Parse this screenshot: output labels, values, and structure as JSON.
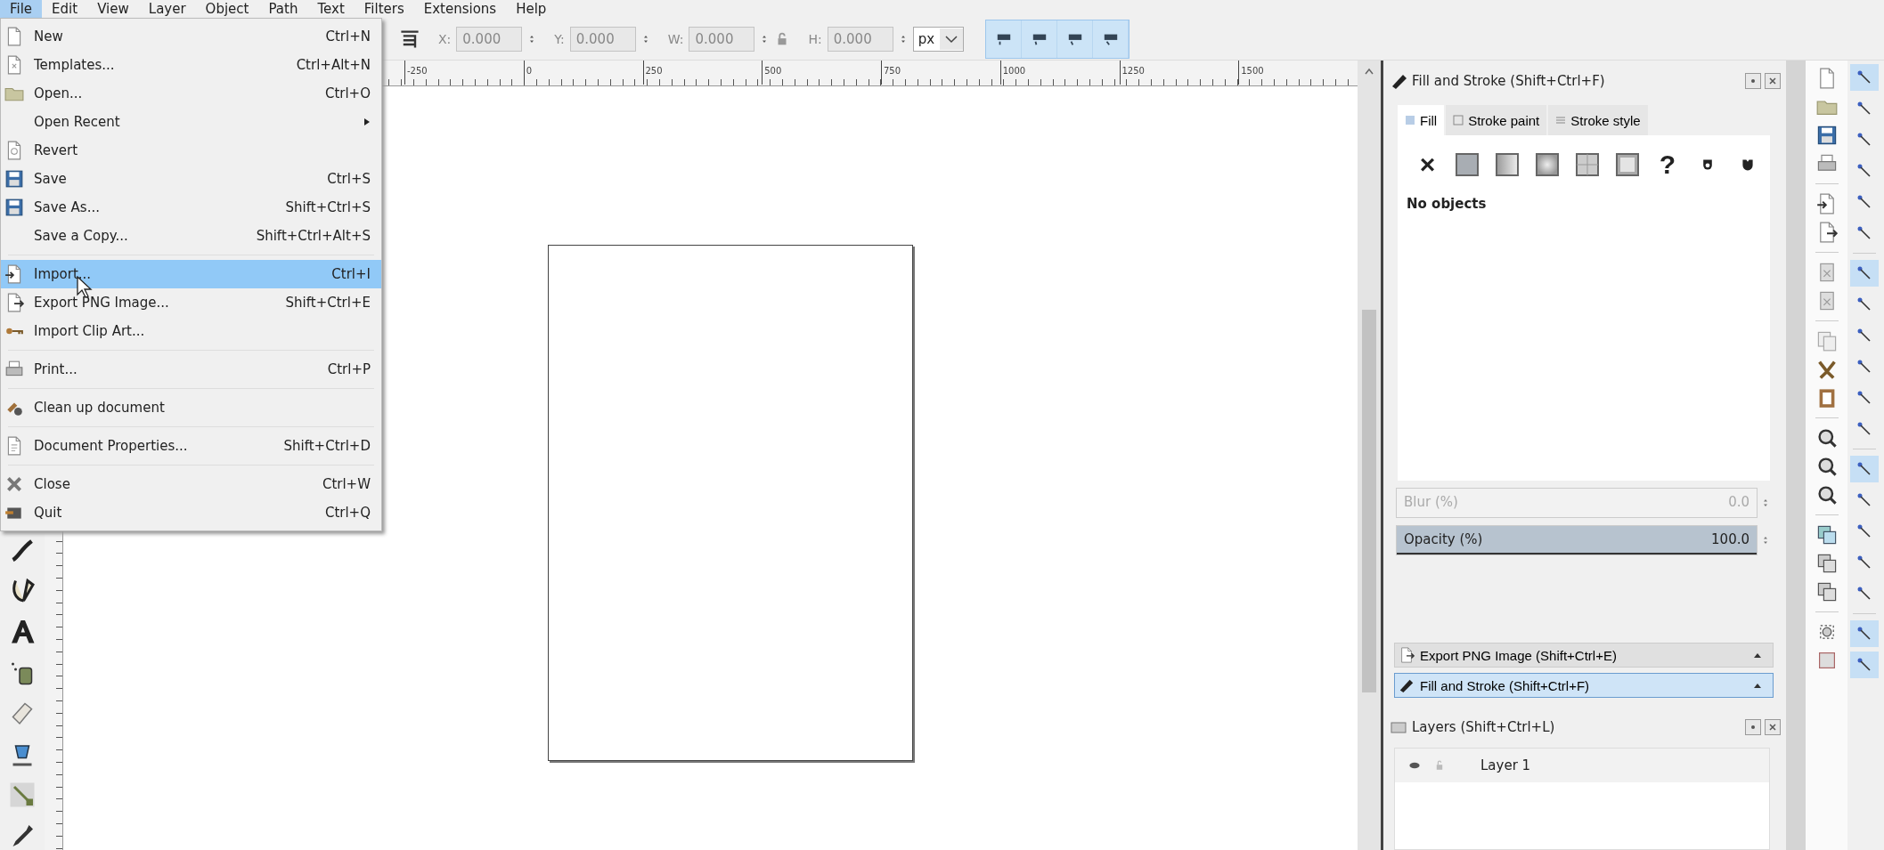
{
  "menubar": {
    "items": [
      {
        "label": "File",
        "selected": true
      },
      {
        "label": "Edit",
        "selected": false
      },
      {
        "label": "View",
        "selected": false
      },
      {
        "label": "Layer",
        "selected": false
      },
      {
        "label": "Object",
        "selected": false
      },
      {
        "label": "Path",
        "selected": false
      },
      {
        "label": "Text",
        "selected": false
      },
      {
        "label": "Filters",
        "selected": false
      },
      {
        "label": "Extensions",
        "selected": false
      },
      {
        "label": "Help",
        "selected": false
      }
    ]
  },
  "file_menu": {
    "items": [
      {
        "kind": "item",
        "label": "New",
        "shortcut": "Ctrl+N",
        "selected": false
      },
      {
        "kind": "item",
        "label": "Templates...",
        "shortcut": "Ctrl+Alt+N",
        "selected": false
      },
      {
        "kind": "item",
        "label": "Open...",
        "shortcut": "Ctrl+O",
        "selected": false
      },
      {
        "kind": "submenu",
        "label": "Open Recent",
        "selected": false
      },
      {
        "kind": "item",
        "label": "Revert",
        "selected": false
      },
      {
        "kind": "item",
        "label": "Save",
        "shortcut": "Ctrl+S",
        "selected": false
      },
      {
        "kind": "item",
        "label": "Save As...",
        "shortcut": "Shift+Ctrl+S",
        "selected": false
      },
      {
        "kind": "item",
        "label": "Save a Copy...",
        "shortcut": "Shift+Ctrl+Alt+S",
        "selected": false
      },
      {
        "kind": "separator"
      },
      {
        "kind": "item",
        "label": "Import...",
        "shortcut": "Ctrl+I",
        "selected": true
      },
      {
        "kind": "item",
        "label": "Export PNG Image...",
        "shortcut": "Shift+Ctrl+E",
        "selected": false
      },
      {
        "kind": "item",
        "label": "Import Clip Art...",
        "selected": false
      },
      {
        "kind": "separator"
      },
      {
        "kind": "item",
        "label": "Print...",
        "shortcut": "Ctrl+P",
        "selected": false
      },
      {
        "kind": "separator"
      },
      {
        "kind": "item",
        "label": "Clean up document",
        "selected": false
      },
      {
        "kind": "separator"
      },
      {
        "kind": "item",
        "label": "Document Properties...",
        "shortcut": "Shift+Ctrl+D",
        "selected": false
      },
      {
        "kind": "separator"
      },
      {
        "kind": "item",
        "label": "Close",
        "shortcut": "Ctrl+W",
        "selected": false
      },
      {
        "kind": "item",
        "label": "Quit",
        "shortcut": "Ctrl+Q",
        "selected": false
      }
    ]
  },
  "toolbar": {
    "fields": [
      {
        "label": "X:",
        "value": "0.000",
        "disabled": true
      },
      {
        "label": "Y:",
        "value": "0.000",
        "disabled": true
      },
      {
        "label": "W:",
        "value": "0.000",
        "disabled": true
      },
      {
        "label": "H:",
        "value": "0.000",
        "disabled": true
      }
    ],
    "unit": "px",
    "toggles": [
      {
        "on": true
      },
      {
        "on": true
      },
      {
        "on": true
      },
      {
        "on": true
      }
    ]
  },
  "ruler": {
    "labels": [
      "-250",
      "0",
      "250",
      "500",
      "750",
      "1000",
      "1250",
      "1500"
    ]
  },
  "fill_stroke_panel": {
    "title": "Fill and Stroke (Shift+Ctrl+F)",
    "tabs": [
      {
        "label": "Fill",
        "selected": true
      },
      {
        "label": "Stroke paint",
        "selected": false
      },
      {
        "label": "Stroke style",
        "selected": false
      }
    ],
    "paint_buttons": [
      {
        "kind": "none",
        "symbol": "×"
      },
      {
        "kind": "flat"
      },
      {
        "kind": "linear"
      },
      {
        "kind": "radial"
      },
      {
        "kind": "mesh"
      },
      {
        "kind": "pattern"
      },
      {
        "kind": "unset",
        "symbol": "?"
      },
      {
        "kind": "rule-evenodd"
      },
      {
        "kind": "rule-nonzero"
      }
    ],
    "status": "No objects",
    "sliders": [
      {
        "label": "Blur (%)",
        "value": "0.0",
        "level": 0,
        "disabled": true
      },
      {
        "label": "Opacity (%)",
        "value": "100.0",
        "level": 1,
        "disabled": false
      }
    ]
  },
  "dock_tabs": [
    {
      "label": "Export PNG Image (Shift+Ctrl+E)",
      "selected": false
    },
    {
      "label": "Fill and Stroke (Shift+Ctrl+F)",
      "selected": true
    }
  ],
  "layers_panel": {
    "title": "Layers (Shift+Ctrl+L)",
    "layers": [
      {
        "name": "Layer 1"
      }
    ]
  },
  "snap_bar": {
    "buttons": [
      {
        "on": true
      },
      {
        "on": false
      },
      {
        "on": false
      },
      {
        "on": false
      },
      {
        "on": false
      },
      {
        "on": false
      },
      {
        "on": true
      },
      {
        "on": false
      },
      {
        "on": false
      },
      {
        "on": false
      },
      {
        "on": false
      },
      {
        "on": false
      },
      {
        "on": true
      },
      {
        "on": false
      },
      {
        "on": false
      },
      {
        "on": false
      },
      {
        "on": false
      },
      {
        "on": true
      },
      {
        "on": true
      }
    ]
  }
}
